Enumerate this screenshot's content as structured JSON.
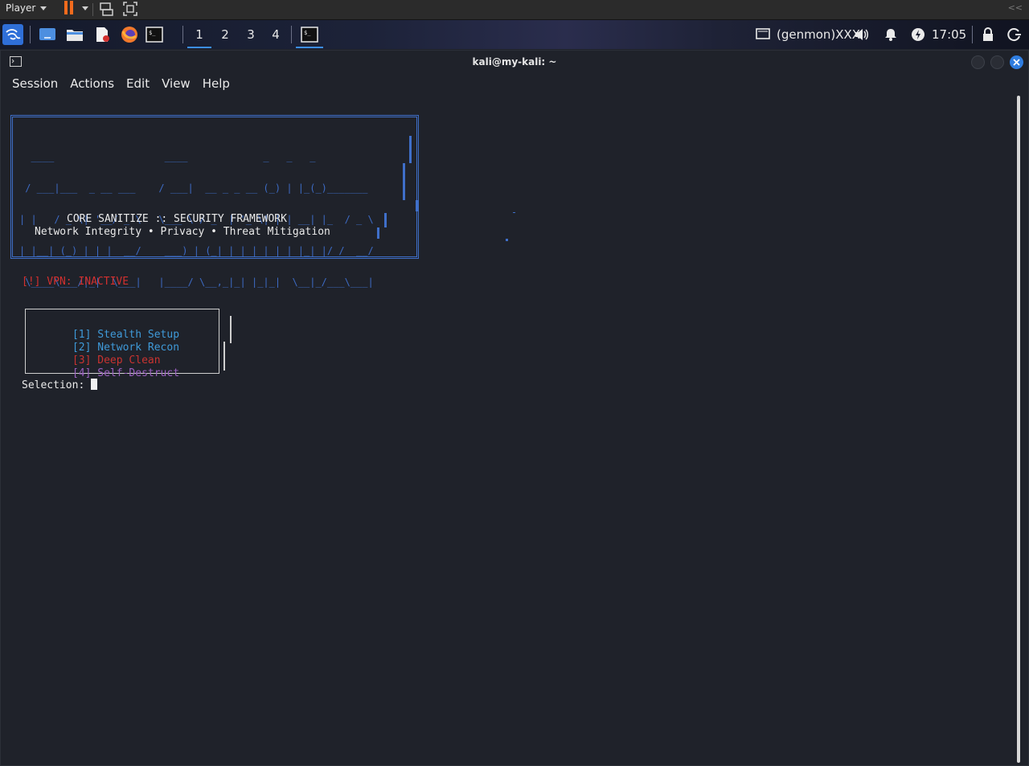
{
  "player": {
    "menu_label": "Player"
  },
  "panel": {
    "workspaces": [
      "1",
      "2",
      "3",
      "4"
    ],
    "tray": {
      "genmon": "(genmon)XXX",
      "clock": "17:05"
    }
  },
  "window": {
    "title": "kali@my-kali: ~",
    "menu": [
      "Session",
      "Actions",
      "Edit",
      "View",
      "Help"
    ]
  },
  "terminal": {
    "banner": {
      "ascii_art": [
        "  ____                   ____             _   _   _",
        " / ___|___  _ __ ___    / ___|  __ _ _ __ (_) | |_(_)_______",
        "| |   / _ \\| '__/ _ \\   \\___ \\ / _` | '_ \\| | | __| |_  / _ \\",
        "| |__| (_) | | |  __/    ___) | (_| | | | | | | |_| |/ /  __/",
        " \\____\\___/|_|  \\___|   |____/ \\__,_|_| |_|_|  \\__|_/___\\___|"
      ],
      "line1": "CORE SANITIZE :: SECURITY FRAMEWORK",
      "line2": "Network Integrity • Privacy • Threat Mitigation"
    },
    "vpn_status": "[!] VPN: INACTIVE",
    "options": [
      {
        "key": "[1]",
        "label": "Stealth Setup"
      },
      {
        "key": "[2]",
        "label": "Network Recon"
      },
      {
        "key": "[3]",
        "label": "Deep Clean"
      },
      {
        "key": "[4]",
        "label": "Self-Destruct"
      }
    ],
    "prompt": "Selection:"
  },
  "colors": {
    "accent_blue": "#3f6fc9",
    "option_blue": "#3f9ad9",
    "warn_red": "#d2302f",
    "purple": "#9a5fbf",
    "terminal_bg": "#1f222a"
  }
}
